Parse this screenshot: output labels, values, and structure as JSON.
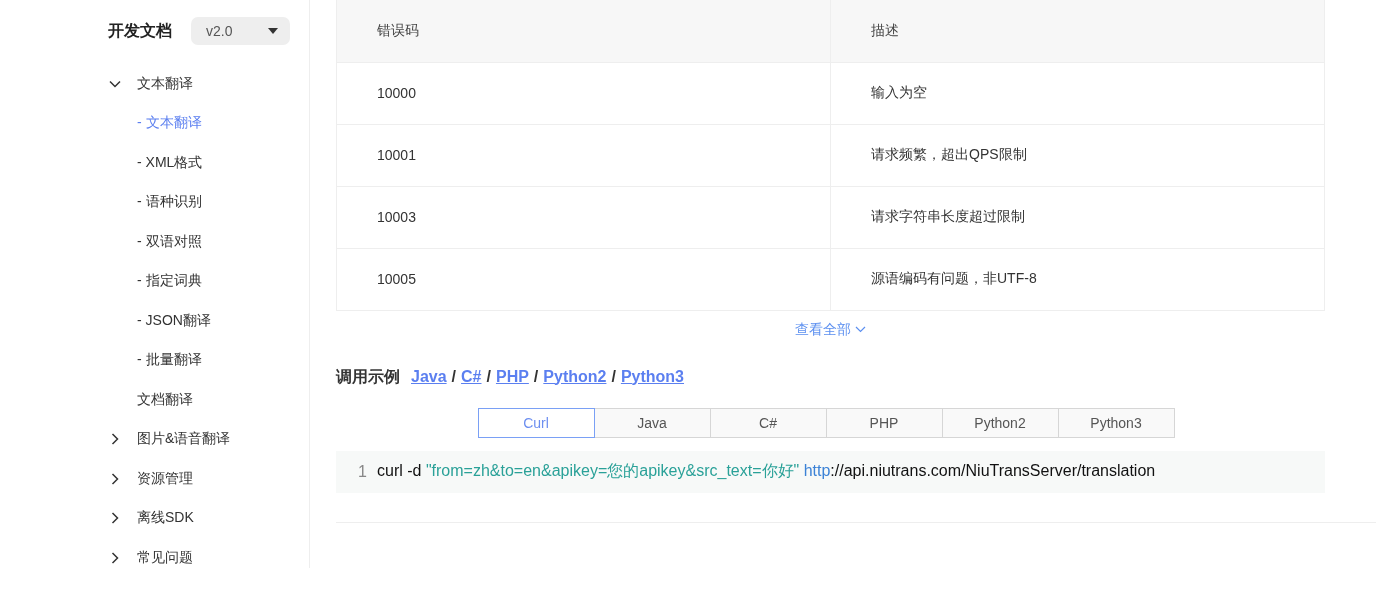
{
  "sidebar": {
    "title": "开发文档",
    "version": "v2.0",
    "items": [
      {
        "label": "文本翻译",
        "expanded": true,
        "children": [
          {
            "label": "- 文本翻译",
            "selected": true
          },
          {
            "label": "- XML格式",
            "selected": false
          },
          {
            "label": "- 语种识别",
            "selected": false
          },
          {
            "label": "- 双语对照",
            "selected": false
          },
          {
            "label": "- 指定词典",
            "selected": false
          },
          {
            "label": "- JSON翻译",
            "selected": false
          },
          {
            "label": "- 批量翻译",
            "selected": false
          },
          {
            "label": "文档翻译",
            "selected": false
          }
        ]
      },
      {
        "label": "图片&语音翻译",
        "expanded": false
      },
      {
        "label": "资源管理",
        "expanded": false
      },
      {
        "label": "离线SDK",
        "expanded": false
      },
      {
        "label": "常见问题",
        "expanded": false
      }
    ]
  },
  "error_table": {
    "columns": [
      "错误码",
      "描述"
    ],
    "rows": [
      [
        "10000",
        "输入为空"
      ],
      [
        "10001",
        "请求频繁，超出QPS限制"
      ],
      [
        "10003",
        "请求字符串长度超过限制"
      ],
      [
        "10005",
        "源语编码有问题，非UTF-8"
      ]
    ],
    "show_all": "查看全部"
  },
  "example": {
    "heading": "调用示例",
    "links": [
      {
        "kind": "link",
        "text": "Java"
      },
      {
        "kind": "separator",
        "text": "/"
      },
      {
        "kind": "link",
        "text": "C#"
      },
      {
        "kind": "separator",
        "text": "/"
      },
      {
        "kind": "link",
        "text": "PHP"
      },
      {
        "kind": "separator",
        "text": "/"
      },
      {
        "kind": "link",
        "text": "Python2"
      },
      {
        "kind": "separator",
        "text": "/"
      },
      {
        "kind": "link",
        "text": "Python3"
      }
    ],
    "tabs": [
      {
        "label": "Curl",
        "selected": true
      },
      {
        "label": "Java",
        "selected": false
      },
      {
        "label": "C#",
        "selected": false
      },
      {
        "label": "PHP",
        "selected": false
      },
      {
        "label": "Python2",
        "selected": false
      },
      {
        "label": "Python3",
        "selected": false
      }
    ],
    "code_lines": [
      {
        "number": "1",
        "tokens": [
          {
            "kind": "plain",
            "text": "curl -d "
          },
          {
            "kind": "string",
            "text": "\"from=zh&to=en&apikey=您的apikey&src_text=你好\" "
          },
          {
            "kind": "keyword",
            "text": "http"
          },
          {
            "kind": "plain",
            "text": "://api.niutrans.com/NiuTransServer/translation"
          }
        ]
      }
    ]
  }
}
